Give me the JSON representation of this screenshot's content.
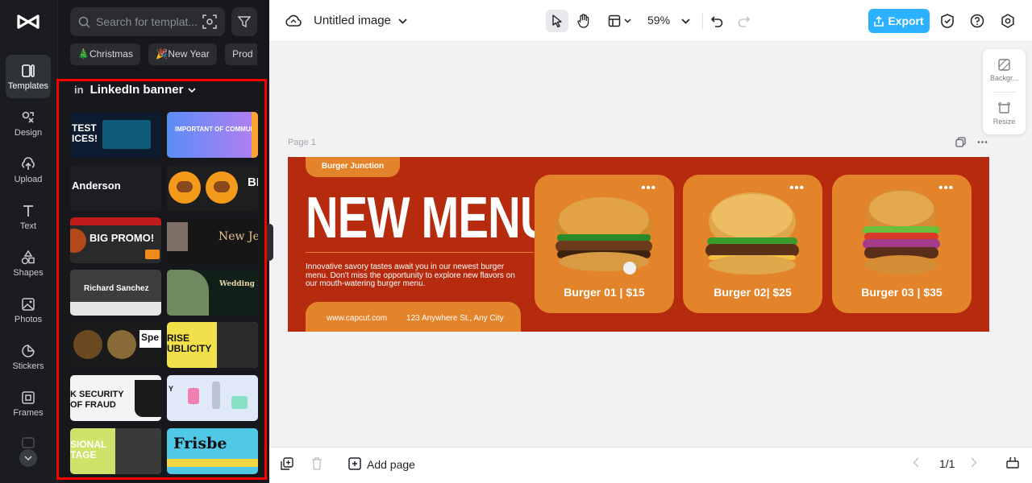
{
  "rail": {
    "items": [
      {
        "label": "Templates",
        "icon": "templates-icon",
        "active": true
      },
      {
        "label": "Design",
        "icon": "design-icon"
      },
      {
        "label": "Upload",
        "icon": "upload-icon"
      },
      {
        "label": "Text",
        "icon": "text-icon"
      },
      {
        "label": "Shapes",
        "icon": "shapes-icon"
      },
      {
        "label": "Photos",
        "icon": "photos-icon"
      },
      {
        "label": "Stickers",
        "icon": "stickers-icon"
      },
      {
        "label": "Frames",
        "icon": "frames-icon"
      }
    ]
  },
  "panel": {
    "search_placeholder": "Search for templat...",
    "chips": [
      "🎄Christmas",
      "🎉New Year",
      "Prod"
    ],
    "section_title": "LinkedIn banner",
    "section_icon": "in",
    "thumbs": [
      {
        "text": "TEST\nICES!",
        "bg": "#0c1b2e"
      },
      {
        "text": "IMPORTANT OF COMMUNICATION",
        "bg": "#6b7bf5"
      },
      {
        "text": "Anderson",
        "bg": "#1c1e22"
      },
      {
        "text": "BI",
        "bg": "#1e1e1e"
      },
      {
        "text": "BIG PROMO!",
        "bg": "#2a2a2a"
      },
      {
        "text": "New Je",
        "bg": "#161616"
      },
      {
        "text": "Richard Sanchez",
        "bg": "#3d3d3d"
      },
      {
        "text": "Wedding Ri",
        "bg": "#102018"
      },
      {
        "text": "Spe",
        "bg": "#1a1a1a"
      },
      {
        "text": "RISE UBLICITY",
        "bg": "#f2e04a"
      },
      {
        "text": "K SECURITY OF FRAUD",
        "bg": "#f4f4f4"
      },
      {
        "text": "Y",
        "bg": "#dfe9f7"
      },
      {
        "text": "SIONAL TAGE",
        "bg": "#cfe36a"
      },
      {
        "text": "Frisbe",
        "bg": "#4fc9e6"
      }
    ]
  },
  "topbar": {
    "title": "Untitled image",
    "zoom": "59%",
    "export_label": "Export"
  },
  "side_tools": {
    "background_label": "Backgr...",
    "resize_label": "Resize"
  },
  "canvas": {
    "page_label": "Page 1"
  },
  "banner": {
    "brand": "Burger Junction",
    "headline": "NEW MENU",
    "description": "Innovative savory tastes await you in our newest burger menu. Don't miss the opportunity to explore new flavors on our mouth-watering burger menu.",
    "website": "www.capcut.com",
    "address": "123 Anywhere St., Any City",
    "cards": [
      {
        "label": "Burger 01 | $15"
      },
      {
        "label": "Burger 02| $25"
      },
      {
        "label": "Burger 03 | $35"
      }
    ],
    "colors": {
      "background": "#b62b0e",
      "accent": "#e4842a"
    }
  },
  "bottombar": {
    "add_page": "Add page",
    "page_counter": "1/1"
  },
  "colors": {
    "accent": "#2bb1ff",
    "highlight": "#ff0000"
  }
}
